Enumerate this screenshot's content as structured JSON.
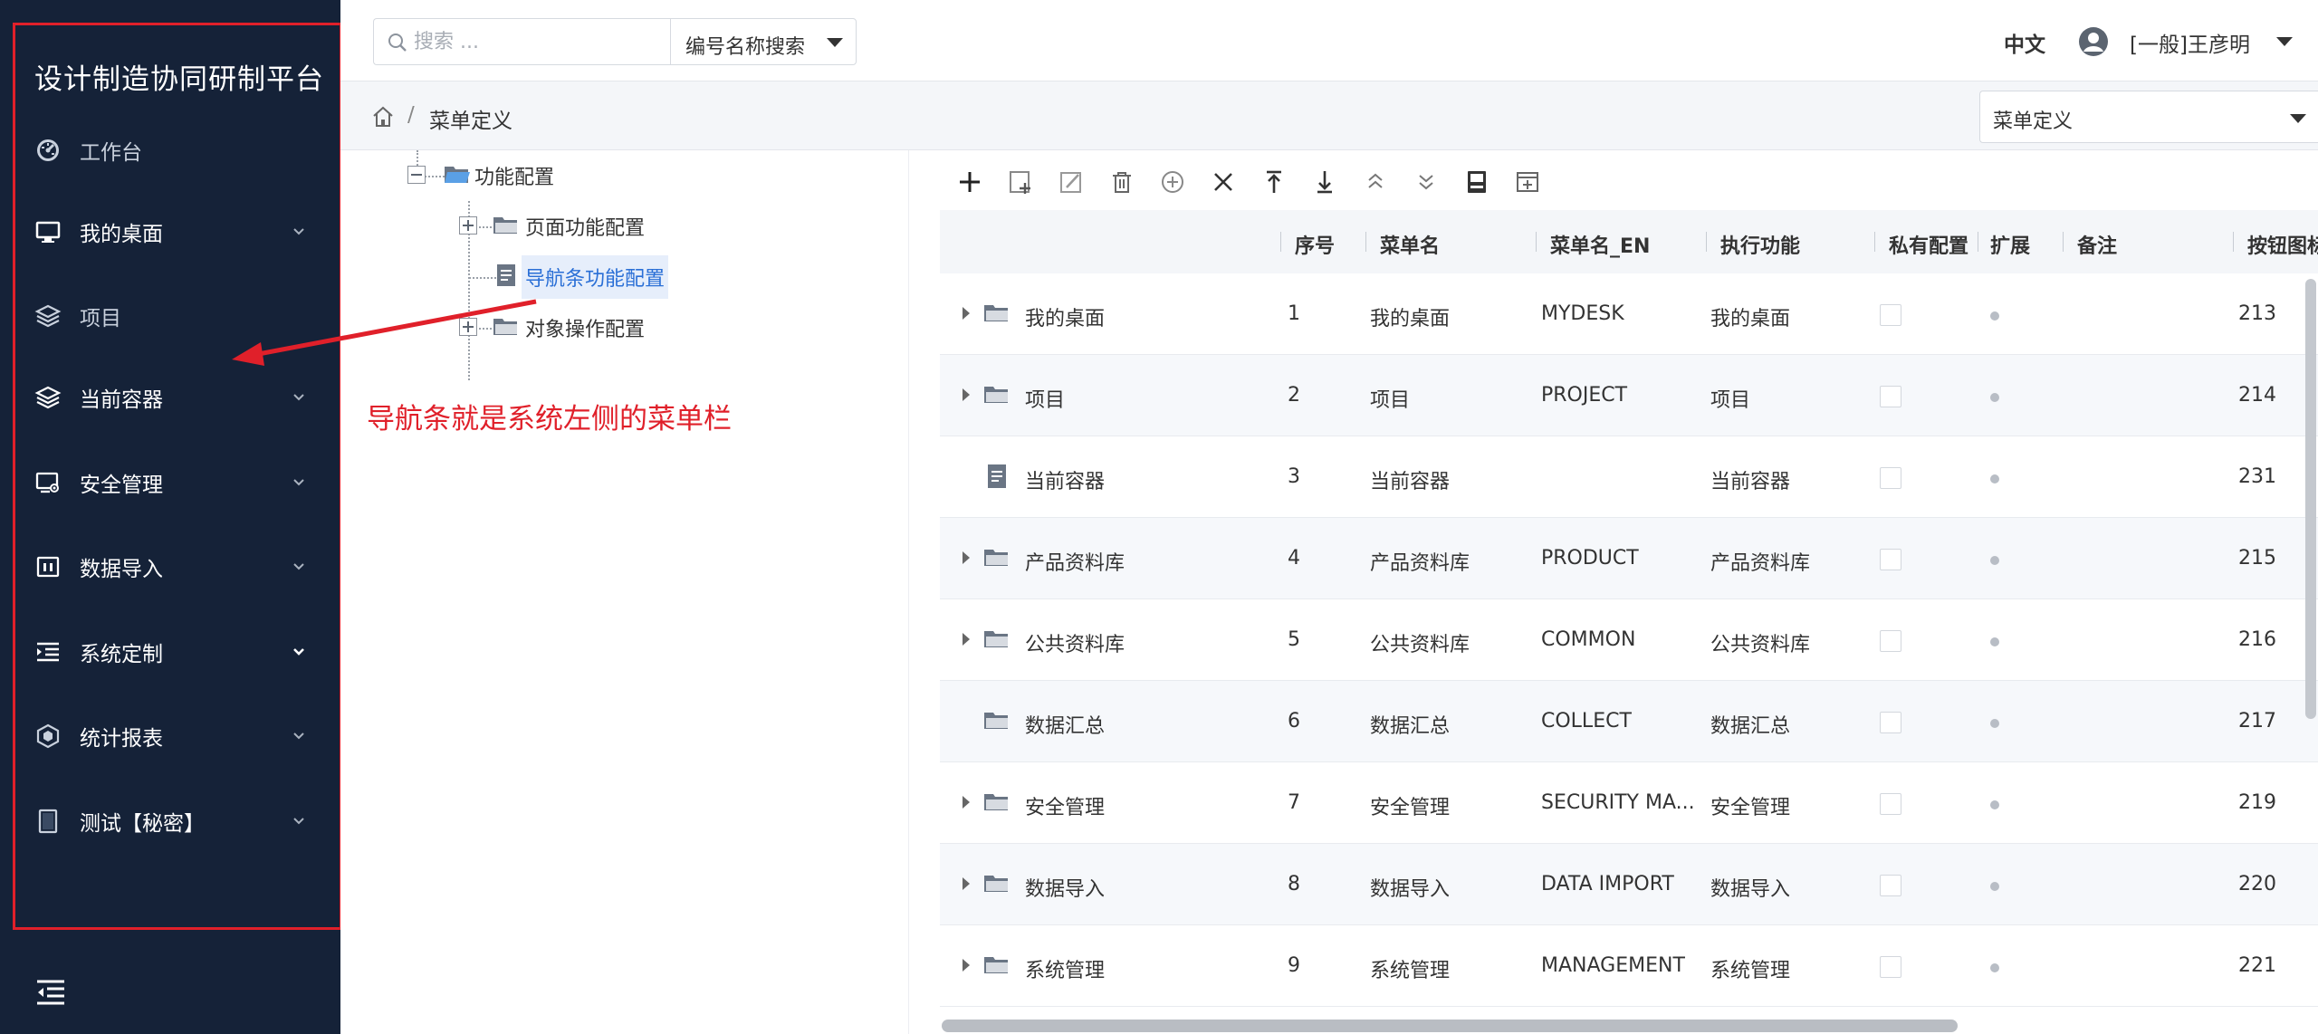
{
  "sidebar": {
    "brand": "设计制造协同研制平台",
    "items": [
      {
        "label": "工作台",
        "icon": "dashboard-icon",
        "has_chevron": false
      },
      {
        "label": "我的桌面",
        "icon": "monitor-icon",
        "has_chevron": true
      },
      {
        "label": "项目",
        "icon": "layers-icon",
        "has_chevron": false
      },
      {
        "label": "当前容器",
        "icon": "stack-icon",
        "has_chevron": true
      },
      {
        "label": "安全管理",
        "icon": "security-settings-icon",
        "has_chevron": true
      },
      {
        "label": "数据导入",
        "icon": "import-icon",
        "has_chevron": true
      },
      {
        "label": "系统定制",
        "icon": "indent-icon",
        "has_chevron": true
      },
      {
        "label": "统计报表",
        "icon": "hexagon-icon",
        "has_chevron": true
      },
      {
        "label": "测试【秘密】",
        "icon": "document-icon",
        "has_chevron": true
      }
    ],
    "collapse_icon": "collapse-menu-icon"
  },
  "header": {
    "search_placeholder": "搜索 ...",
    "search_mode": "编号名称搜索",
    "language": "中文",
    "user": "[一般]王彦明"
  },
  "breadcrumb": {
    "separator": "/",
    "current": "菜单定义"
  },
  "view_select": {
    "value": "菜单定义"
  },
  "tree": {
    "nodes": [
      {
        "label": "功能配置",
        "state": "expanded"
      },
      {
        "label": "页面功能配置",
        "state": "collapsed"
      },
      {
        "label": "导航条功能配置",
        "state": "selected"
      },
      {
        "label": "对象操作配置",
        "state": "collapsed"
      }
    ]
  },
  "toolbar": {
    "buttons": [
      "add-icon",
      "add-child-icon",
      "edit-icon",
      "delete-icon",
      "add-circle-icon",
      "close-icon",
      "move-top-icon",
      "move-bottom-icon",
      "move-up-icon",
      "move-down-icon",
      "save-icon",
      "insert-icon"
    ]
  },
  "table": {
    "headers": {
      "seq": "序号",
      "name": "菜单名",
      "name_en": "菜单名_EN",
      "func": "执行功能",
      "private": "私有配置",
      "ext": "扩展",
      "note": "备注",
      "btn_icon": "按钮图标"
    },
    "rows": [
      {
        "tree_label": "我的桌面",
        "kind": "folder",
        "seq": "1",
        "name": "我的桌面",
        "name_en": "MYDESK",
        "func": "我的桌面",
        "btn_icon": "213"
      },
      {
        "tree_label": "项目",
        "kind": "folder",
        "seq": "2",
        "name": "项目",
        "name_en": "PROJECT",
        "func": "项目",
        "btn_icon": "214"
      },
      {
        "tree_label": "当前容器",
        "kind": "doc",
        "seq": "3",
        "name": "当前容器",
        "name_en": "",
        "func": "当前容器",
        "btn_icon": "231"
      },
      {
        "tree_label": "产品资料库",
        "kind": "folder",
        "seq": "4",
        "name": "产品资料库",
        "name_en": "PRODUCT",
        "func": "产品资料库",
        "btn_icon": "215"
      },
      {
        "tree_label": "公共资料库",
        "kind": "folder",
        "seq": "5",
        "name": "公共资料库",
        "name_en": "COMMON",
        "func": "公共资料库",
        "btn_icon": "216"
      },
      {
        "tree_label": "数据汇总",
        "kind": "folder-leaf",
        "seq": "6",
        "name": "数据汇总",
        "name_en": "COLLECT",
        "func": "数据汇总",
        "btn_icon": "217"
      },
      {
        "tree_label": "安全管理",
        "kind": "folder",
        "seq": "7",
        "name": "安全管理",
        "name_en": "SECURITY MA...",
        "func": "安全管理",
        "btn_icon": "219"
      },
      {
        "tree_label": "数据导入",
        "kind": "folder",
        "seq": "8",
        "name": "数据导入",
        "name_en": "DATA IMPORT",
        "func": "数据导入",
        "btn_icon": "220"
      },
      {
        "tree_label": "系统管理",
        "kind": "folder",
        "seq": "9",
        "name": "系统管理",
        "name_en": "MANAGEMENT",
        "func": "系统管理",
        "btn_icon": "221"
      }
    ]
  },
  "annotation": {
    "text": "导航条就是系统左侧的菜单栏",
    "color": "#e0202a"
  },
  "colors": {
    "sidebar_bg": "#152238",
    "accent": "#2a6fd6",
    "annotation": "#e0202a"
  }
}
